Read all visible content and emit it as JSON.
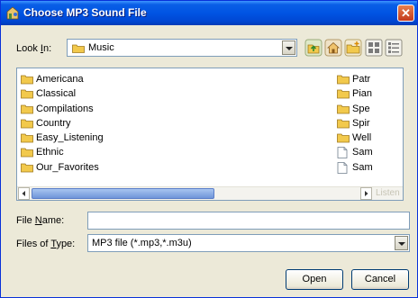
{
  "window": {
    "title": "Choose MP3 Sound File",
    "close_glyph": "✕"
  },
  "look_in": {
    "label_pre": "Look ",
    "label_ul": "I",
    "label_post": "n:",
    "value": "Music"
  },
  "toolbar": {
    "icons": [
      "up-folder-icon",
      "home-icon",
      "new-folder-icon",
      "list-view-icon",
      "details-view-icon"
    ]
  },
  "files": {
    "left_column": [
      "Americana",
      "Classical",
      "Compilations",
      "Country",
      "Easy_Listening",
      "Ethnic",
      "Our_Favorites"
    ],
    "right_column": [
      {
        "name": "Patr",
        "type": "folder"
      },
      {
        "name": "Pian",
        "type": "folder"
      },
      {
        "name": "Spe",
        "type": "folder"
      },
      {
        "name": "Spir",
        "type": "folder"
      },
      {
        "name": "Well",
        "type": "folder"
      },
      {
        "name": "Sam",
        "type": "file"
      },
      {
        "name": "Sam",
        "type": "file"
      }
    ],
    "listen_label": "Listen"
  },
  "file_name": {
    "label_pre": "File ",
    "label_ul": "N",
    "label_post": "ame:",
    "value": ""
  },
  "files_of_type": {
    "label_pre": "Files of ",
    "label_ul": "T",
    "label_post": "ype:",
    "value": "MP3 file (*.mp3,*.m3u)"
  },
  "buttons": {
    "open": "Open",
    "cancel": "Cancel"
  },
  "colors": {
    "title_bar": "#0054e3",
    "dialog_bg": "#ece9d8",
    "folder": "#f2c94c"
  }
}
